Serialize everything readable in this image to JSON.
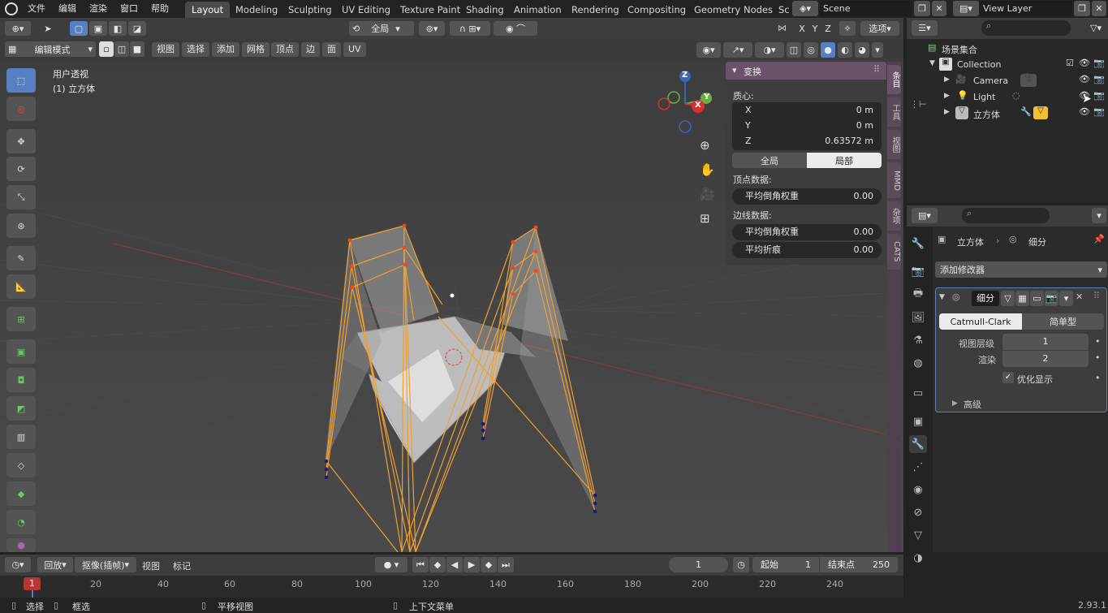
{
  "topbar": {
    "menus": [
      "文件",
      "编辑",
      "渲染",
      "窗口",
      "帮助"
    ],
    "workspaces": [
      "Layout",
      "Modeling",
      "Sculpting",
      "UV Editing",
      "Texture Paint",
      "Shading",
      "Animation",
      "Rendering",
      "Compositing",
      "Geometry Nodes",
      "Sc"
    ],
    "scene": "Scene",
    "view_layer": "View Layer"
  },
  "toolbar_header": {
    "orientation": "全局",
    "options": "选项",
    "axes": [
      "X",
      "Y",
      "Z"
    ]
  },
  "viewport_header": {
    "mode": "编辑模式",
    "menus": [
      "视图",
      "选择",
      "添加",
      "网格",
      "顶点",
      "边",
      "面",
      "UV"
    ]
  },
  "viewport": {
    "view_name": "用户透视",
    "object_name": "(1) 立方体",
    "gizmo_axes": [
      "Z",
      "Y",
      "X"
    ]
  },
  "npanel": {
    "title": "变换",
    "median_label": "质心:",
    "x_label": "X",
    "x_value": "0 m",
    "y_label": "Y",
    "y_value": "0 m",
    "z_label": "Z",
    "z_value": "0.63572 m",
    "global_label": "全局",
    "local_label": "局部",
    "vertex_data": "顶点数据:",
    "vertex_bevel": "平均倒角权重",
    "vertex_bevel_value": "0.00",
    "edge_data": "边线数据:",
    "edge_bevel": "平均倒角权重",
    "edge_bevel_value": "0.00",
    "edge_crease": "平均折痕",
    "edge_crease_value": "0.00",
    "tabs": [
      "条目",
      "工具",
      "视图",
      "MMD",
      "杂项",
      "CATS"
    ]
  },
  "outliner": {
    "scene_collection": "场景集合",
    "items": [
      {
        "label": "Collection"
      },
      {
        "label": "Camera"
      },
      {
        "label": "Light"
      },
      {
        "label": "立方体"
      }
    ]
  },
  "properties": {
    "object": "立方体",
    "modifier_name_header": "细分",
    "add_modifier": "添加修改器",
    "modifier_name": "细分",
    "catmull": "Catmull-Clark",
    "simple": "简单型",
    "levels_label": "视图层级",
    "levels_value": "1",
    "render_label": "渲染",
    "render_value": "2",
    "optimal": "优化显示",
    "advanced": "高级"
  },
  "timeline": {
    "playback": "回放",
    "keying": "抠像(插帧)",
    "view": "视图",
    "marker": "标记",
    "current_frame": "1",
    "start_label": "起始",
    "start_value": "1",
    "end_label": "结束点",
    "end_value": "250",
    "ruler": [
      "20",
      "40",
      "60",
      "80",
      "100",
      "120",
      "140",
      "160",
      "180",
      "200",
      "220",
      "240"
    ],
    "playhead": "1"
  },
  "statusbar": {
    "select": "选择",
    "box_select": "框选",
    "pan": "平移视图",
    "context_menu": "上下文菜单",
    "version": "2.93.1"
  },
  "colors": {
    "accent": "#5680c2",
    "wire": "#f0a030",
    "vertex_selected": "#ff5020",
    "vertex_unselected": "#1a1a80"
  }
}
